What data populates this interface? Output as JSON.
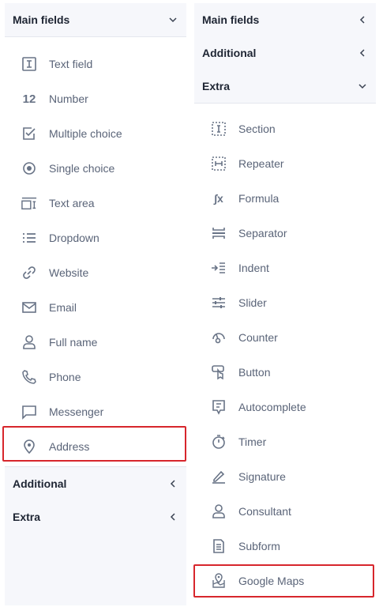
{
  "left": {
    "main_title": "Main fields",
    "items": [
      {
        "label": "Text field",
        "icon": "text-field-icon"
      },
      {
        "label": "Number",
        "icon": "number-icon",
        "glyph": "12"
      },
      {
        "label": "Multiple choice",
        "icon": "checkbox-icon"
      },
      {
        "label": "Single choice",
        "icon": "radio-icon"
      },
      {
        "label": "Text area",
        "icon": "text-area-icon"
      },
      {
        "label": "Dropdown",
        "icon": "list-icon"
      },
      {
        "label": "Website",
        "icon": "link-icon"
      },
      {
        "label": "Email",
        "icon": "mail-icon"
      },
      {
        "label": "Full name",
        "icon": "user-icon"
      },
      {
        "label": "Phone",
        "icon": "phone-icon"
      },
      {
        "label": "Messenger",
        "icon": "chat-icon"
      },
      {
        "label": "Address",
        "icon": "location-icon"
      }
    ],
    "additional_title": "Additional",
    "extra_title": "Extra"
  },
  "right": {
    "main_title": "Main fields",
    "additional_title": "Additional",
    "extra_title": "Extra",
    "items": [
      {
        "label": "Section",
        "icon": "section-icon"
      },
      {
        "label": "Repeater",
        "icon": "repeater-icon"
      },
      {
        "label": "Formula",
        "icon": "formula-icon",
        "glyph": "∫x"
      },
      {
        "label": "Separator",
        "icon": "separator-icon"
      },
      {
        "label": "Indent",
        "icon": "indent-icon"
      },
      {
        "label": "Slider",
        "icon": "slider-icon"
      },
      {
        "label": "Counter",
        "icon": "counter-icon"
      },
      {
        "label": "Button",
        "icon": "button-icon"
      },
      {
        "label": "Autocomplete",
        "icon": "autocomplete-icon"
      },
      {
        "label": "Timer",
        "icon": "timer-icon"
      },
      {
        "label": "Signature",
        "icon": "signature-icon"
      },
      {
        "label": "Consultant",
        "icon": "consultant-icon"
      },
      {
        "label": "Subform",
        "icon": "subform-icon"
      },
      {
        "label": "Google Maps",
        "icon": "map-icon"
      }
    ]
  },
  "colors": {
    "highlight": "#d7262c",
    "panel_bg": "#f6f7fb",
    "text": "#5a6478",
    "icon": "#687386"
  }
}
